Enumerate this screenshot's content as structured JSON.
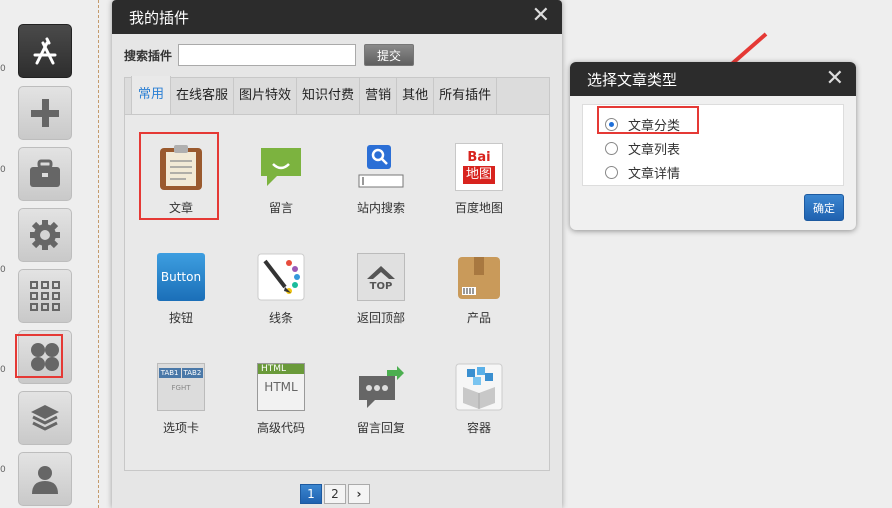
{
  "ruler_marks": [
    "0",
    "0",
    "0",
    "0",
    "0"
  ],
  "toolbar": {
    "items": [
      {
        "icon": "app-store-icon"
      },
      {
        "icon": "plus-icon"
      },
      {
        "icon": "briefcase-icon"
      },
      {
        "icon": "gear-icon"
      },
      {
        "icon": "grid-icon"
      },
      {
        "icon": "plugins-icon"
      },
      {
        "icon": "layers-icon"
      },
      {
        "icon": "user-icon"
      }
    ]
  },
  "plugin_dialog": {
    "title": "我的插件",
    "close": "✕",
    "search_label": "搜索插件",
    "search_value": "",
    "submit_label": "提交",
    "tabs": [
      "常用",
      "在线客服",
      "图片特效",
      "知识付费",
      "营销",
      "其他",
      "所有插件"
    ],
    "active_tab": "常用",
    "items": [
      {
        "label": "文章",
        "icon": "article-icon"
      },
      {
        "label": "留言",
        "icon": "message-icon"
      },
      {
        "label": "站内搜索",
        "icon": "site-search-icon"
      },
      {
        "label": "百度地图",
        "icon": "baidu-map-icon"
      },
      {
        "label": "按钮",
        "icon": "button-icon"
      },
      {
        "label": "线条",
        "icon": "lines-icon"
      },
      {
        "label": "返回顶部",
        "icon": "back-to-top-icon"
      },
      {
        "label": "产品",
        "icon": "product-icon"
      },
      {
        "label": "选项卡",
        "icon": "tabs-icon"
      },
      {
        "label": "高级代码",
        "icon": "html-code-icon"
      },
      {
        "label": "留言回复",
        "icon": "reply-icon"
      },
      {
        "label": "容器",
        "icon": "container-icon"
      }
    ],
    "icon_text": {
      "button": "Button",
      "baidu": "Bai",
      "map": "地图",
      "top": "TOP",
      "html": "HTML",
      "tab1": "TAB1",
      "tab2": "TAB2",
      "tab_content": "FGHT"
    },
    "pages": [
      "1",
      "2",
      "›"
    ],
    "current_page": "1"
  },
  "type_dialog": {
    "title": "选择文章类型",
    "close": "✕",
    "options": [
      {
        "label": "文章分类",
        "selected": true
      },
      {
        "label": "文章列表",
        "selected": false
      },
      {
        "label": "文章详情",
        "selected": false
      }
    ],
    "confirm_label": "确定"
  },
  "colors": {
    "accent": "#2a7fd4",
    "highlight": "#e53935",
    "header_bg": "#2c2c2c"
  }
}
